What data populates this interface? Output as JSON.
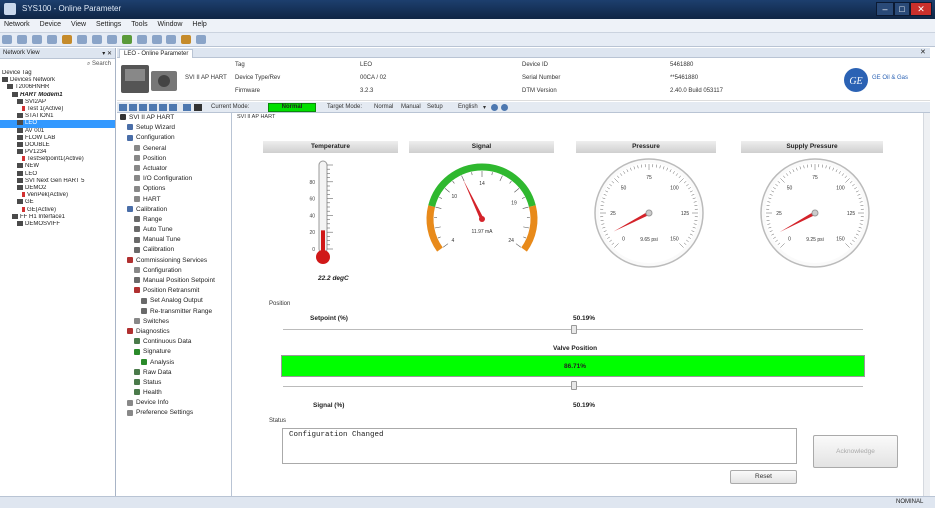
{
  "window": {
    "title": "SYS100 - Online Parameter"
  },
  "menu": [
    "Network",
    "Device",
    "View",
    "Settings",
    "Tools",
    "Window",
    "Help"
  ],
  "nav": {
    "header": "Network View",
    "search": "Search",
    "items": [
      {
        "label": "Device Tag",
        "indent": 0,
        "icon": "none"
      },
      {
        "label": "Devices Network",
        "indent": 0,
        "icon": "network"
      },
      {
        "label": "T2006HNHR",
        "indent": 1,
        "icon": "pc"
      },
      {
        "label": "HART Modem1",
        "indent": 2,
        "icon": "modem",
        "italic": true
      },
      {
        "label": "SVI2AP",
        "indent": 3,
        "icon": "device"
      },
      {
        "label": "Test 1(Active)",
        "indent": 4,
        "icon": "tag"
      },
      {
        "label": "STATION1",
        "indent": 3,
        "icon": "device"
      },
      {
        "label": "LEO",
        "indent": 3,
        "icon": "device",
        "selected": true
      },
      {
        "label": "AV 001",
        "indent": 3,
        "icon": "device"
      },
      {
        "label": "FLOW LAB",
        "indent": 3,
        "icon": "device"
      },
      {
        "label": "DOUBLE",
        "indent": 3,
        "icon": "device"
      },
      {
        "label": "PV1234",
        "indent": 3,
        "icon": "device"
      },
      {
        "label": "TestSetpoint1(Active)",
        "indent": 4,
        "icon": "tag"
      },
      {
        "label": "NEW",
        "indent": 3,
        "icon": "device"
      },
      {
        "label": "LEO",
        "indent": 3,
        "icon": "device"
      },
      {
        "label": "SVI Next Gen HART 5",
        "indent": 3,
        "icon": "device"
      },
      {
        "label": "DEMO2",
        "indent": 3,
        "icon": "device"
      },
      {
        "label": "VeriPek(Active)",
        "indent": 4,
        "icon": "tag"
      },
      {
        "label": "GE",
        "indent": 3,
        "icon": "device"
      },
      {
        "label": "GE(Active)",
        "indent": 4,
        "icon": "tag"
      },
      {
        "label": "FF H1 Interface1",
        "indent": 2,
        "icon": "modem"
      },
      {
        "label": "DEMOSVIFF",
        "indent": 3,
        "icon": "device"
      }
    ]
  },
  "tab": {
    "label": "LEO - Online Parameter"
  },
  "device": {
    "model": "SVI II AP HART",
    "tag_label": "Tag",
    "tag": "LEO",
    "type_label": "Device Type/Rev",
    "type": "00CA / 02",
    "fw_label": "Firmware",
    "fw": "3.2.3",
    "id_label": "Device ID",
    "id": "5461880",
    "serial_label": "Serial Number",
    "serial": "**5461880",
    "dtm_label": "DTM Version",
    "dtm": "2.40.0 Build 053117",
    "brand": "GE Oil & Gas"
  },
  "modebar": {
    "current_mode_label": "Current Mode:",
    "current_mode": "Normal",
    "target_mode_label": "Target Mode:",
    "modes": [
      "Normal",
      "Manual",
      "Setup"
    ],
    "language": "English"
  },
  "tree": {
    "items": [
      {
        "label": "SVI II AP HART",
        "level": 0,
        "icon": "device"
      },
      {
        "label": "Setup Wizard",
        "level": 1,
        "icon": "wizard"
      },
      {
        "label": "Configuration",
        "level": 1,
        "icon": "config"
      },
      {
        "label": "General",
        "level": 2,
        "icon": "wrench"
      },
      {
        "label": "Position",
        "level": 2,
        "icon": "wrench"
      },
      {
        "label": "Actuator",
        "level": 2,
        "icon": "wrench"
      },
      {
        "label": "I/O Configuration",
        "level": 2,
        "icon": "wrench"
      },
      {
        "label": "Options",
        "level": 2,
        "icon": "wrench"
      },
      {
        "label": "HART",
        "level": 2,
        "icon": "wrench"
      },
      {
        "label": "Calibration",
        "level": 1,
        "icon": "calib"
      },
      {
        "label": "Range",
        "level": 2,
        "icon": "calibsub"
      },
      {
        "label": "Auto Tune",
        "level": 2,
        "icon": "calibsub"
      },
      {
        "label": "Manual Tune",
        "level": 2,
        "icon": "calibsub"
      },
      {
        "label": "Calibration",
        "level": 2,
        "icon": "calibsub"
      },
      {
        "label": "Commissioning Services",
        "level": 1,
        "icon": "comm"
      },
      {
        "label": "Configuration",
        "level": 2,
        "icon": "wrench"
      },
      {
        "label": "Manual Position Setpoint",
        "level": 2,
        "icon": "calibsub"
      },
      {
        "label": "Position Retransmit",
        "level": 2,
        "icon": "comm"
      },
      {
        "label": "Set Analog Output",
        "level": 3,
        "icon": "calibsub"
      },
      {
        "label": "Re-transmitter Range",
        "level": 3,
        "icon": "calibsub"
      },
      {
        "label": "Switches",
        "level": 2,
        "icon": "wrench"
      },
      {
        "label": "Diagnostics",
        "level": 1,
        "icon": "diag"
      },
      {
        "label": "Continuous Data",
        "level": 2,
        "icon": "data"
      },
      {
        "label": "Signature",
        "level": 2,
        "icon": "sig"
      },
      {
        "label": "Analysis",
        "level": 3,
        "icon": "sig"
      },
      {
        "label": "Raw Data",
        "level": 2,
        "icon": "data"
      },
      {
        "label": "Status",
        "level": 2,
        "icon": "data"
      },
      {
        "label": "Health",
        "level": 2,
        "icon": "data"
      },
      {
        "label": "Device Info",
        "level": 1,
        "icon": "wrench"
      },
      {
        "label": "Preference Settings",
        "level": 1,
        "icon": "wrench"
      }
    ]
  },
  "panel": {
    "breadcrumb": "SVI II AP HART",
    "temperature": {
      "title": "Temperature",
      "value": "22.2 degC",
      "min": 0,
      "max": 100,
      "level": 22.2,
      "ticks": [
        "80",
        "60",
        "40",
        "20",
        "0"
      ]
    },
    "signal": {
      "title": "Signal",
      "value": "11.97 mA",
      "min": 4,
      "max": 24,
      "reading": 11.97,
      "ticks": [
        "4",
        "10",
        "14",
        "19",
        "24"
      ]
    },
    "pressure": {
      "title": "Pressure",
      "value": "9.65 psi",
      "min": 0,
      "max": 150,
      "reading": 9.65,
      "ticks": [
        "0",
        "25",
        "50",
        "75",
        "100",
        "125",
        "150"
      ]
    },
    "supply_pressure": {
      "title": "Supply Pressure",
      "value": "9.25 psi",
      "min": 0,
      "max": 150,
      "reading": 9.25,
      "ticks": [
        "0",
        "25",
        "50",
        "75",
        "100",
        "125",
        "150"
      ]
    },
    "position_label": "Position",
    "setpoint_label": "Setpoint (%)",
    "setpoint_value": "50.19%",
    "setpoint_fraction": 0.5019,
    "valve_position_label": "Valve Position",
    "valve_position_value": "86.71%",
    "valve_position_fraction": 1.0,
    "signal_pct_label": "Signal (%)",
    "signal_pct_value": "50.19%",
    "signal_fraction": 0.5019,
    "status_label": "Status",
    "status_text": "Configuration Changed",
    "acknowledge_label": "Acknowledge",
    "reset_label": "Reset"
  },
  "statusbar": {
    "right": "NOMINAL"
  },
  "colors": {
    "valve_bar": "#00ff00",
    "mode_badge": "#00e000",
    "selected": "#3399ff",
    "needle": "#d4232a",
    "thermo": "#d01818"
  }
}
